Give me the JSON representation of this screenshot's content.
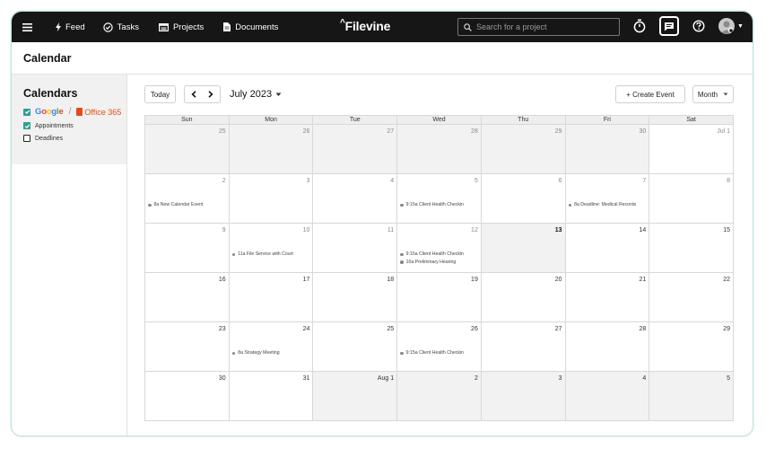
{
  "nav": {
    "items": [
      {
        "label": "Feed",
        "icon": "lightning-icon"
      },
      {
        "label": "Tasks",
        "icon": "check-circle-icon"
      },
      {
        "label": "Projects",
        "icon": "projects-icon"
      },
      {
        "label": "Documents",
        "icon": "document-icon"
      }
    ],
    "brand": "Filevine",
    "search_placeholder": "Search for a project"
  },
  "page": {
    "title": "Calendar"
  },
  "sidebar": {
    "title": "Calendars",
    "providers": {
      "google": "Google",
      "office": "Office 365",
      "separator": "/"
    },
    "calendars": [
      {
        "label": "Appointments",
        "checked": true
      },
      {
        "label": "Deadlines",
        "checked": false
      }
    ]
  },
  "toolbar": {
    "today": "Today",
    "month_label": "July 2023",
    "create_event": "+  Create Event",
    "view": "Month"
  },
  "calendar": {
    "weekdays": [
      "Sun",
      "Mon",
      "Tue",
      "Wed",
      "Thu",
      "Fri",
      "Sat"
    ],
    "weeks": [
      [
        {
          "day": "25",
          "muted": true,
          "events": []
        },
        {
          "day": "26",
          "muted": true,
          "events": []
        },
        {
          "day": "27",
          "muted": true,
          "events": []
        },
        {
          "day": "28",
          "muted": true,
          "events": []
        },
        {
          "day": "29",
          "muted": true,
          "events": []
        },
        {
          "day": "30",
          "muted": true,
          "events": []
        },
        {
          "day": "Jul 1",
          "muted": false,
          "events": []
        }
      ],
      [
        {
          "day": "2",
          "events": [
            "8a New Calendar Event"
          ]
        },
        {
          "day": "3",
          "events": []
        },
        {
          "day": "4",
          "events": []
        },
        {
          "day": "5",
          "events": [
            "9:15a Client Health Checkin"
          ]
        },
        {
          "day": "6",
          "events": []
        },
        {
          "day": "7",
          "events": [
            "8a Deadline: Medical Records"
          ]
        },
        {
          "day": "8",
          "events": []
        }
      ],
      [
        {
          "day": "9",
          "events": []
        },
        {
          "day": "10",
          "events": [
            "11a File Service with Court"
          ]
        },
        {
          "day": "11",
          "events": []
        },
        {
          "day": "12",
          "events": [
            "9:15a Client Health Checkin",
            "10a Preliminary Hearing"
          ]
        },
        {
          "day": "13",
          "today": true,
          "events": []
        },
        {
          "day": "14",
          "current": true,
          "events": []
        },
        {
          "day": "15",
          "current": true,
          "events": []
        }
      ],
      [
        {
          "day": "16",
          "current": true,
          "events": []
        },
        {
          "day": "17",
          "current": true,
          "events": []
        },
        {
          "day": "18",
          "current": true,
          "events": []
        },
        {
          "day": "19",
          "current": true,
          "events": []
        },
        {
          "day": "20",
          "current": true,
          "events": []
        },
        {
          "day": "21",
          "current": true,
          "events": []
        },
        {
          "day": "22",
          "current": true,
          "events": []
        }
      ],
      [
        {
          "day": "23",
          "current": true,
          "events": []
        },
        {
          "day": "24",
          "current": true,
          "events": [
            "8a Strategy Meeting"
          ]
        },
        {
          "day": "25",
          "current": true,
          "events": []
        },
        {
          "day": "26",
          "current": true,
          "events": [
            "9:15a Client Health Checkin"
          ]
        },
        {
          "day": "27",
          "current": true,
          "events": []
        },
        {
          "day": "28",
          "current": true,
          "events": []
        },
        {
          "day": "29",
          "current": true,
          "events": []
        }
      ],
      [
        {
          "day": "30",
          "current": true,
          "events": []
        },
        {
          "day": "31",
          "current": true,
          "events": []
        },
        {
          "day": "Aug 1",
          "muted": true,
          "current": true,
          "events": []
        },
        {
          "day": "2",
          "muted": true,
          "current": true,
          "events": []
        },
        {
          "day": "3",
          "muted": true,
          "current": true,
          "events": []
        },
        {
          "day": "4",
          "muted": true,
          "current": true,
          "events": []
        },
        {
          "day": "5",
          "muted": true,
          "current": true,
          "events": []
        }
      ]
    ]
  },
  "colors": {
    "accent": "#2e9e92",
    "nav_bg": "#161616",
    "frame_border": "#bfe3e0"
  }
}
